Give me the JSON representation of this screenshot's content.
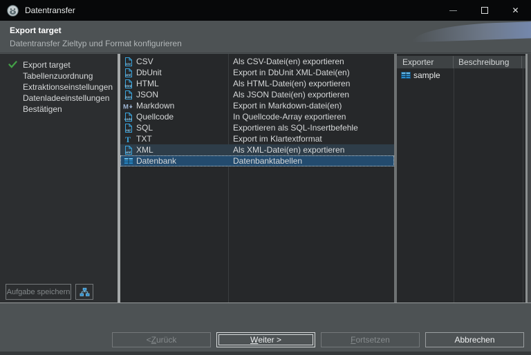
{
  "window": {
    "title": "Datentransfer",
    "controls": {
      "minimize_glyph": "",
      "close_glyph": "✕"
    }
  },
  "header": {
    "title": "Export target",
    "subtitle": "Datentransfer Zieltyp und Format konfigurieren"
  },
  "steps": {
    "items": [
      {
        "label": "Export target",
        "checked": true
      },
      {
        "label": "Tabellenzuordnung",
        "checked": false
      },
      {
        "label": "Extraktionseinstellungen",
        "checked": false
      },
      {
        "label": "Datenladeeinstellungen",
        "checked": false
      },
      {
        "label": "Bestätigen",
        "checked": false
      }
    ]
  },
  "task": {
    "save_label": "Aufgabe speichern"
  },
  "formats": {
    "rows": [
      {
        "icon": "csv-file-icon",
        "name": "CSV",
        "description": "Als CSV-Datei(en) exportieren",
        "state": "normal"
      },
      {
        "icon": "xml-file-icon",
        "name": "DbUnit",
        "description": "Export in DbUnit XML-Datei(en)",
        "state": "normal"
      },
      {
        "icon": "html-file-icon",
        "name": "HTML",
        "description": "Als HTML-Datei(en) exportieren",
        "state": "normal"
      },
      {
        "icon": "json-file-icon",
        "name": "JSON",
        "description": "Als JSON Datei(en) exportieren",
        "state": "normal"
      },
      {
        "icon": "markdown-icon",
        "name": "Markdown",
        "description": "Export in Markdown-datei(en)",
        "state": "normal"
      },
      {
        "icon": "code-file-icon",
        "name": "Quellcode",
        "description": "In Quellcode-Array exportieren",
        "state": "normal"
      },
      {
        "icon": "sql-file-icon",
        "name": "SQL",
        "description": "Exportieren als SQL-Insertbefehle",
        "state": "normal"
      },
      {
        "icon": "txt-icon",
        "name": "TXT",
        "description": "Export im Klartextformat",
        "state": "normal"
      },
      {
        "icon": "xml-file-icon",
        "name": "XML",
        "description": "Als XML-Datei(en) exportieren",
        "state": "highlighted"
      },
      {
        "icon": "database-table-icon",
        "name": "Datenbank",
        "description": "Datenbanktabellen",
        "state": "selected"
      }
    ]
  },
  "exporters": {
    "columns": [
      "Exporter",
      "Beschreibung"
    ],
    "rows": [
      {
        "icon": "database-table-icon",
        "name": "sample",
        "description": ""
      }
    ]
  },
  "footer": {
    "buttons": [
      {
        "name": "back-button",
        "pre": "< ",
        "accel": "Z",
        "post": "urück",
        "enabled": false,
        "default": false
      },
      {
        "name": "next-button",
        "pre": "",
        "accel": "W",
        "post": "eiter >",
        "enabled": true,
        "default": true
      },
      {
        "name": "proceed-button",
        "pre": "",
        "accel": "F",
        "post": "ortsetzen",
        "enabled": false,
        "default": false
      },
      {
        "name": "cancel-button",
        "pre": "",
        "accel": "",
        "post": "Abbrechen",
        "enabled": true,
        "default": false
      }
    ]
  },
  "colors": {
    "accent_blue": "#3aa5de",
    "selection_blue": "#234b6e",
    "highlight_row": "#2e3d49",
    "check_green": "#43a047",
    "titlebar": "#070809",
    "chrome_gray": "#4d5254",
    "panel_dark": "#26282a"
  }
}
